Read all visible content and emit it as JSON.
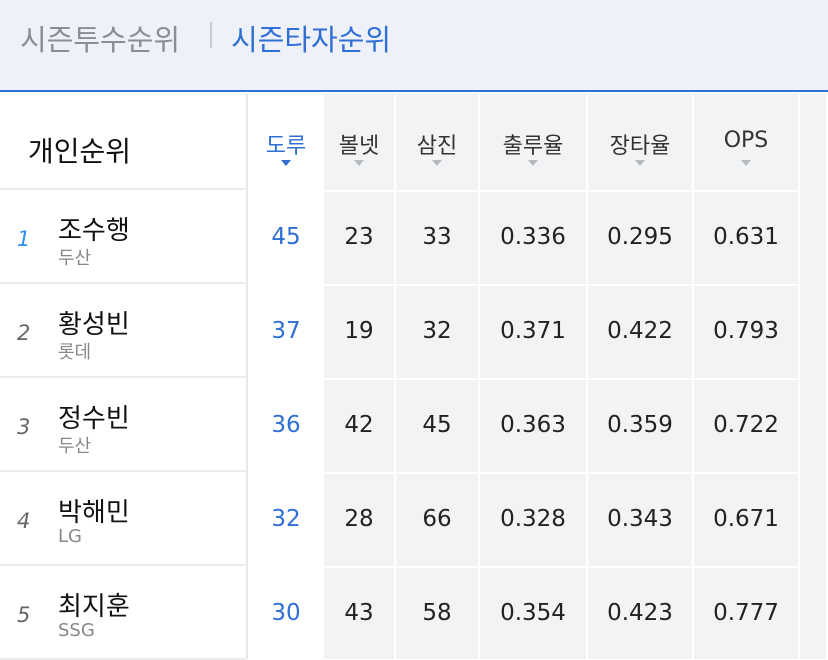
{
  "tabs": {
    "pitcher": "시즌투수순위",
    "batter": "시즌타자순위"
  },
  "left": {
    "title": "개인순위",
    "players": [
      {
        "rank": "1",
        "name": "조수행",
        "team": "두산"
      },
      {
        "rank": "2",
        "name": "황성빈",
        "team": "롯데"
      },
      {
        "rank": "3",
        "name": "정수빈",
        "team": "두산"
      },
      {
        "rank": "4",
        "name": "박해민",
        "team": "LG"
      },
      {
        "rank": "5",
        "name": "최지훈",
        "team": "SSG"
      }
    ]
  },
  "columns": [
    {
      "label": "도루",
      "values": [
        "45",
        "37",
        "36",
        "32",
        "30"
      ]
    },
    {
      "label": "볼넷",
      "values": [
        "23",
        "19",
        "42",
        "28",
        "43"
      ]
    },
    {
      "label": "삼진",
      "values": [
        "33",
        "32",
        "45",
        "66",
        "58"
      ]
    },
    {
      "label": "출루율",
      "values": [
        "0.336",
        "0.371",
        "0.363",
        "0.328",
        "0.354"
      ]
    },
    {
      "label": "장타율",
      "values": [
        "0.295",
        "0.422",
        "0.359",
        "0.343",
        "0.423"
      ]
    },
    {
      "label": "OPS",
      "values": [
        "0.631",
        "0.793",
        "0.722",
        "0.671",
        "0.777"
      ]
    }
  ],
  "colors": {
    "accent": "#2f6fd6",
    "rank_first": "#2f8ff0"
  }
}
